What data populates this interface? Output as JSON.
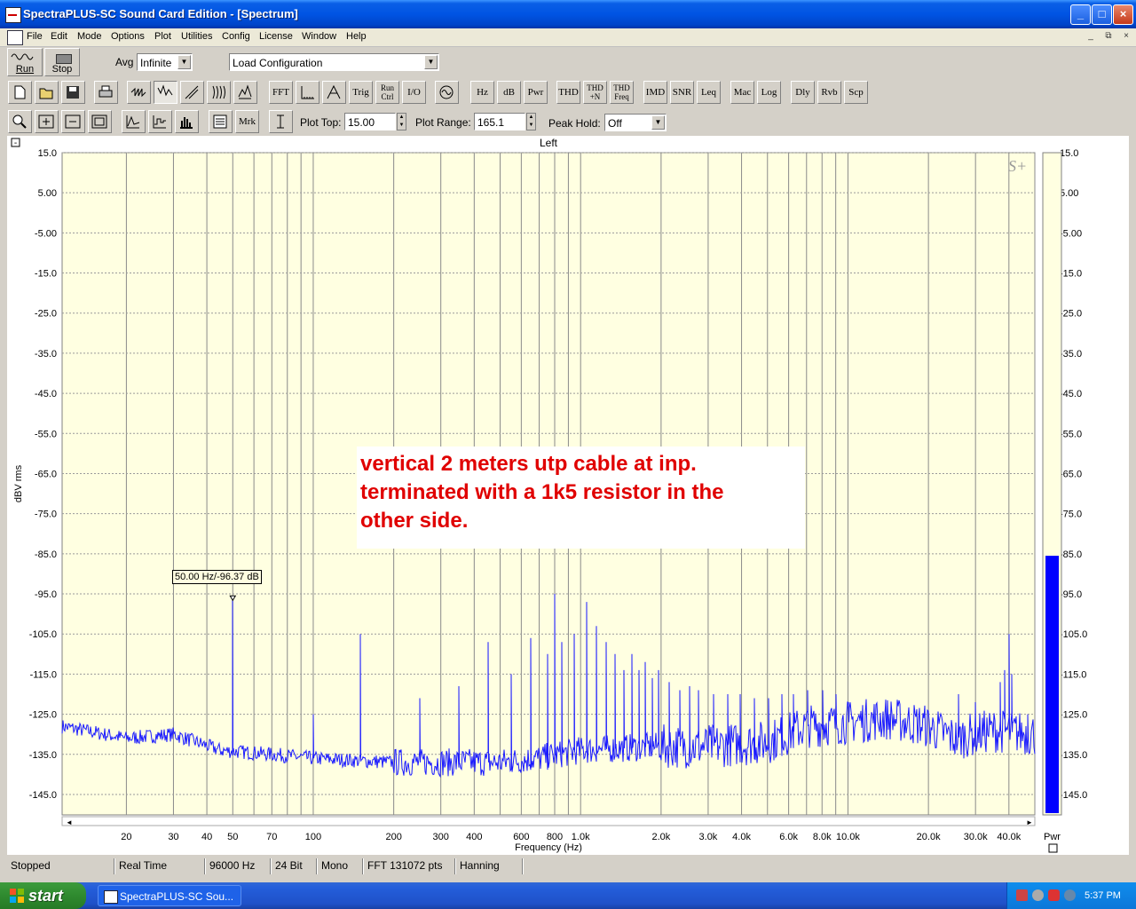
{
  "window": {
    "title": "SpectraPLUS-SC Sound Card Edition - [Spectrum]",
    "caption_buttons": {
      "minimize": "_",
      "maximize": "□",
      "close": "×"
    },
    "mdi_buttons": {
      "minimize": "_",
      "restore": "⧉",
      "close": "×"
    }
  },
  "menu": [
    "File",
    "Edit",
    "Mode",
    "Options",
    "Plot",
    "Utilities",
    "Config",
    "License",
    "Window",
    "Help"
  ],
  "toolbar1": {
    "run_label": "Run",
    "stop_label": "Stop",
    "avg_label": "Avg",
    "avg_value": "Infinite",
    "config_value": "Load Configuration"
  },
  "toolbar2": [
    "FFT",
    "Trig",
    "Run Ctrl",
    "I/O",
    "Hz",
    "dB",
    "Pwr",
    "THD",
    "THD +N",
    "THD Freq",
    "IMD",
    "SNR",
    "Leq",
    "Mac",
    "Log",
    "Dly",
    "Rvb",
    "Scp"
  ],
  "toolbar3": {
    "mrk_label": "Mrk",
    "plot_top_label": "Plot Top:",
    "plot_top_value": "15.00",
    "plot_range_label": "Plot Range:",
    "plot_range_value": "165.1",
    "peak_hold_label": "Peak Hold:",
    "peak_hold_value": "Off"
  },
  "plot": {
    "channel_title": "Left",
    "logo_text": "S+",
    "marker_label": "50.00 Hz/-96.37 dB",
    "annotation_lines": [
      "vertical 2 meters utp cable at inp.",
      "terminated with a 1k5 resistor in the",
      "other side."
    ],
    "meter_label": "Pwr"
  },
  "chart_data": {
    "type": "line",
    "title": "Left",
    "xlabel": "Frequency (Hz)",
    "ylabel": "dBV rms",
    "x_scale": "log",
    "xlim": [
      11.5,
      50000
    ],
    "ylim": [
      -150.1,
      15.0
    ],
    "grid": true,
    "x_tick_labels": [
      {
        "value": 20,
        "label": "20"
      },
      {
        "value": 30,
        "label": "30"
      },
      {
        "value": 40,
        "label": "40"
      },
      {
        "value": 50,
        "label": "50"
      },
      {
        "value": 70,
        "label": "70"
      },
      {
        "value": 100,
        "label": "100"
      },
      {
        "value": 200,
        "label": "200"
      },
      {
        "value": 300,
        "label": "300"
      },
      {
        "value": 400,
        "label": "400"
      },
      {
        "value": 600,
        "label": "600"
      },
      {
        "value": 800,
        "label": "800"
      },
      {
        "value": 1000,
        "label": "1.0k"
      },
      {
        "value": 2000,
        "label": "2.0k"
      },
      {
        "value": 3000,
        "label": "3.0k"
      },
      {
        "value": 4000,
        "label": "4.0k"
      },
      {
        "value": 6000,
        "label": "6.0k"
      },
      {
        "value": 8000,
        "label": "8.0k"
      },
      {
        "value": 10000,
        "label": "10.0k"
      },
      {
        "value": 20000,
        "label": "20.0k"
      },
      {
        "value": 30000,
        "label": "30.0k"
      },
      {
        "value": 40000,
        "label": "40.0k"
      }
    ],
    "y_tick_labels": [
      "15.0",
      "5.00",
      "-5.00",
      "-15.0",
      "-25.0",
      "-35.0",
      "-45.0",
      "-55.0",
      "-65.0",
      "-75.0",
      "-85.0",
      "-95.0",
      "-105.0",
      "-115.0",
      "-125.0",
      "-135.0",
      "-145.0"
    ],
    "noise_floor": [
      {
        "f": 11.5,
        "db": -128
      },
      {
        "f": 20,
        "db": -131
      },
      {
        "f": 30,
        "db": -130
      },
      {
        "f": 45,
        "db": -134
      },
      {
        "f": 70,
        "db": -135
      },
      {
        "f": 100,
        "db": -136
      },
      {
        "f": 200,
        "db": -137
      },
      {
        "f": 500,
        "db": -137
      },
      {
        "f": 700,
        "db": -136
      },
      {
        "f": 1000,
        "db": -134
      },
      {
        "f": 2000,
        "db": -133
      },
      {
        "f": 3000,
        "db": -133
      },
      {
        "f": 5000,
        "db": -132
      },
      {
        "f": 7000,
        "db": -128
      },
      {
        "f": 10000,
        "db": -127
      },
      {
        "f": 14000,
        "db": -126
      },
      {
        "f": 20000,
        "db": -128
      },
      {
        "f": 25000,
        "db": -131
      },
      {
        "f": 35000,
        "db": -129
      },
      {
        "f": 50000,
        "db": -130
      }
    ],
    "peaks": [
      {
        "f": 50,
        "db": -96.37
      },
      {
        "f": 100,
        "db": -125
      },
      {
        "f": 150,
        "db": -105
      },
      {
        "f": 250,
        "db": -121
      },
      {
        "f": 350,
        "db": -118
      },
      {
        "f": 450,
        "db": -107
      },
      {
        "f": 550,
        "db": -115
      },
      {
        "f": 650,
        "db": -106
      },
      {
        "f": 750,
        "db": -110
      },
      {
        "f": 800,
        "db": -95
      },
      {
        "f": 850,
        "db": -107
      },
      {
        "f": 950,
        "db": -105
      },
      {
        "f": 1050,
        "db": -97
      },
      {
        "f": 1150,
        "db": -103
      },
      {
        "f": 1250,
        "db": -107
      },
      {
        "f": 1350,
        "db": -110
      },
      {
        "f": 1450,
        "db": -114
      },
      {
        "f": 1550,
        "db": -110
      },
      {
        "f": 1650,
        "db": -114
      },
      {
        "f": 1750,
        "db": -112
      },
      {
        "f": 1850,
        "db": -116
      },
      {
        "f": 1950,
        "db": -114
      },
      {
        "f": 2150,
        "db": -117
      },
      {
        "f": 2350,
        "db": -119
      },
      {
        "f": 2550,
        "db": -118
      },
      {
        "f": 2750,
        "db": -119
      },
      {
        "f": 3150,
        "db": -120
      },
      {
        "f": 3550,
        "db": -120
      },
      {
        "f": 3950,
        "db": -120
      },
      {
        "f": 4450,
        "db": -121
      },
      {
        "f": 5050,
        "db": -121
      },
      {
        "f": 5650,
        "db": -120
      },
      {
        "f": 6250,
        "db": -120
      },
      {
        "f": 7050,
        "db": -119
      },
      {
        "f": 8050,
        "db": -119
      },
      {
        "f": 9050,
        "db": -120
      },
      {
        "f": 10050,
        "db": -122
      },
      {
        "f": 26000,
        "db": -120
      },
      {
        "f": 30000,
        "db": -122
      },
      {
        "f": 37000,
        "db": -117
      },
      {
        "f": 38500,
        "db": -114
      },
      {
        "f": 40000,
        "db": -105
      },
      {
        "f": 41000,
        "db": -115
      },
      {
        "f": 47000,
        "db": -125
      }
    ],
    "meter_level_db": -85.5,
    "marker": {
      "f": 50,
      "db": -96.37
    }
  },
  "status": [
    "Stopped",
    "Real Time",
    "96000 Hz",
    "24 Bit",
    "Mono",
    "FFT 131072 pts",
    "Hanning"
  ],
  "taskbar": {
    "start_label": "start",
    "task_label": "SpectraPLUS-SC Sou...",
    "clock": "5:37 PM"
  }
}
